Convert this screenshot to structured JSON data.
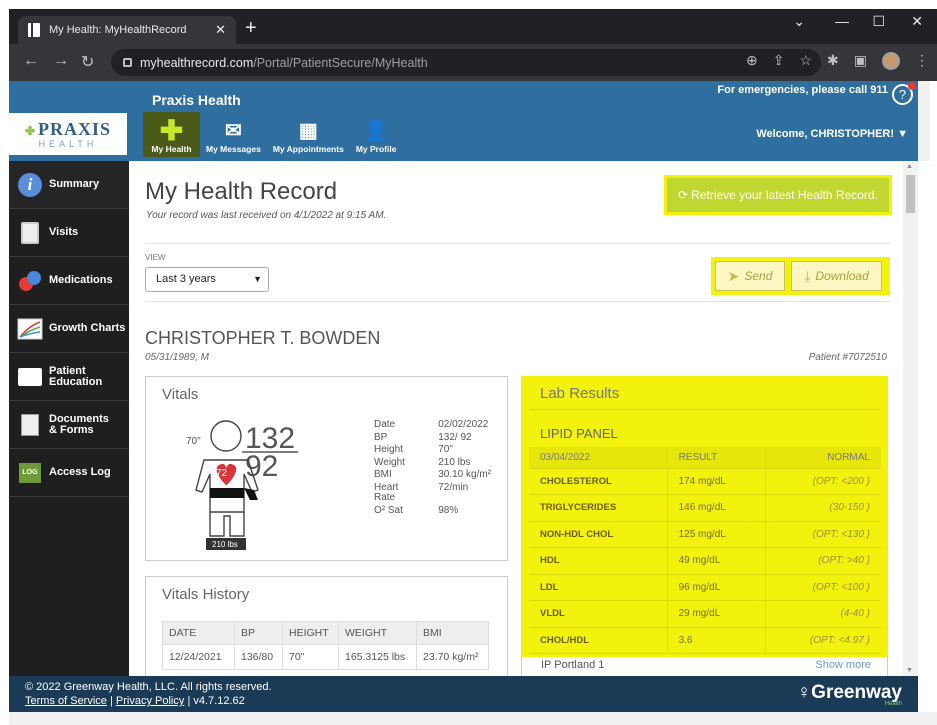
{
  "browser": {
    "tab_title": "My Health: MyHealthRecord",
    "url_host": "myhealthrecord.com",
    "url_path": "/Portal/PatientSecure/MyHealth"
  },
  "header": {
    "org_name": "Praxis Health",
    "emergency": "For emergencies, please call 911",
    "logo_main": "PRAXIS",
    "logo_sub": "HEALTH",
    "nav": [
      {
        "label": "My Health",
        "icon": "plus-icon"
      },
      {
        "label": "My Messages",
        "icon": "messages-icon"
      },
      {
        "label": "My Appointments",
        "icon": "calendar-icon"
      },
      {
        "label": "My Profile",
        "icon": "person-icon"
      }
    ],
    "welcome": "Welcome, CHRISTOPHER! ▼"
  },
  "sidebar": {
    "items": [
      {
        "label": "Summary",
        "icon": "info-icon"
      },
      {
        "label": "Visits",
        "icon": "clipboard-icon"
      },
      {
        "label": "Medications",
        "icon": "pills-icon"
      },
      {
        "label": "Growth Charts",
        "icon": "growth-chart-icon"
      },
      {
        "label": "Patient Education",
        "icon": "book-icon"
      },
      {
        "label": "Documents & Forms",
        "icon": "document-icon"
      },
      {
        "label": "Access Log",
        "icon": "log-icon"
      }
    ]
  },
  "main": {
    "title": "My Health Record",
    "received": "Your record was last received on 4/1/2022 at 9:15 AM.",
    "retrieve_label": "Retrieve your latest Health Record.",
    "view_label": "VIEW",
    "view_value": "Last 3 years",
    "send_label": "Send",
    "download_label": "Download",
    "patient_name": "CHRISTOPHER T. BOWDEN",
    "patient_sub": "05/31/1989, M",
    "patient_no": "Patient #7072510"
  },
  "vitals": {
    "title": "Vitals",
    "height_mark": "70\"",
    "bp_top": "132",
    "bp_bottom": "92",
    "heart_rate": "72",
    "weight_tag": "210 lbs",
    "rows": [
      {
        "label": "Date",
        "value": "02/02/2022"
      },
      {
        "label": "BP",
        "value": "132/ 92"
      },
      {
        "label": "Height",
        "value": "70\""
      },
      {
        "label": "Weight",
        "value": "210 lbs"
      },
      {
        "label": "BMI",
        "value": "30.10 kg/m²"
      },
      {
        "label": "Heart Rate",
        "value": "72/min"
      },
      {
        "label": "O² Sat",
        "value": "98%"
      }
    ]
  },
  "vitals_history": {
    "title": "Vitals History",
    "headers": [
      "DATE",
      "BP",
      "HEIGHT",
      "WEIGHT",
      "BMI"
    ],
    "rows": [
      [
        "12/24/2021",
        "136/80",
        "70\"",
        "165.3125 lbs",
        "23.70 kg/m²"
      ]
    ]
  },
  "lab": {
    "title": "Lab Results",
    "panel": "LIPID PANEL",
    "headers": [
      "03/04/2022",
      "RESULT",
      "NORMAL"
    ],
    "rows": [
      {
        "test": "CHOLESTEROL",
        "result": "174 mg/dL",
        "normal": "(OPT: <200 )"
      },
      {
        "test": "TRIGLYCERIDES",
        "result": "146 mg/dL",
        "normal": "(30-150 )"
      },
      {
        "test": "NON-HDL CHOL",
        "result": "125 mg/dL",
        "normal": "(OPT: <130 )"
      },
      {
        "test": "HDL",
        "result": "49 mg/dL",
        "normal": "(OPT: >40 )"
      },
      {
        "test": "LDL",
        "result": "96 mg/dL",
        "normal": "(OPT: <100 )"
      },
      {
        "test": "VLDL",
        "result": "29 mg/dL",
        "normal": "(4-40 )"
      },
      {
        "test": "CHOL/HDL",
        "result": "3.6",
        "normal": "(OPT: <4.97 )"
      }
    ],
    "location": "IP Portland 1",
    "show_more": "Show more"
  },
  "footer": {
    "copyright": "© 2022 Greenway Health, LLC. All rights reserved.",
    "terms": "Terms of Service",
    "privacy": "Privacy Policy",
    "version": "| v4.7.12.62",
    "brand": "Greenway",
    "brand_sub": "Health"
  },
  "colors": {
    "header_blue": "#2f6fa0",
    "highlight_yellow": "#f2f20c",
    "accent_green": "#bfd730",
    "sidebar_dark": "#1f1f1f"
  }
}
